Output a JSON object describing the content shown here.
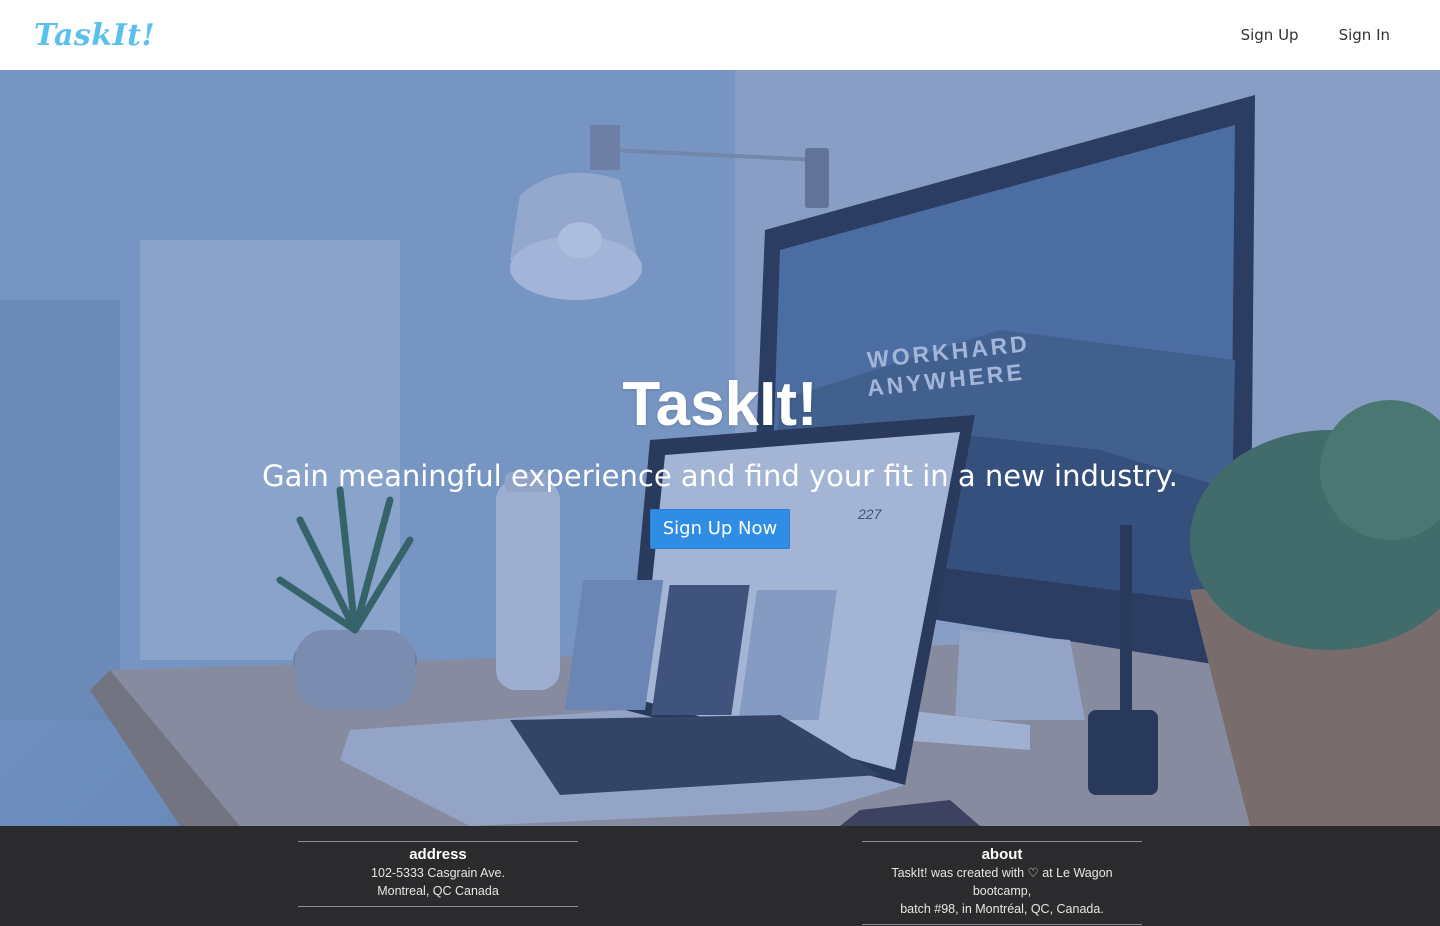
{
  "navbar": {
    "brand": "TaskIt!",
    "links": [
      "Sign Up",
      "Sign In"
    ]
  },
  "hero": {
    "title": "TaskIt!",
    "subtitle": "Gain meaningful experience and find your fit in a new industry.",
    "cta_label": "Sign Up Now",
    "background_scene": {
      "monitor_screen_text_1": "WORKHARD",
      "monitor_screen_text_2": "ANYWHERE",
      "laptop_stat": "227"
    }
  },
  "footer": {
    "address": {
      "heading": "address",
      "lines": [
        "102-5333 Casgrain Ave.",
        "Montreal, QC Canada"
      ]
    },
    "about": {
      "heading": "about",
      "lines": [
        "TaskIt! was created with ♡ at Le Wagon bootcamp,",
        "batch #98, in Montréal, QC, Canada."
      ]
    }
  },
  "colors": {
    "brand": "#5bc0eb",
    "cta": "#2f8de4",
    "footer_bg": "#2b2b2e",
    "hero_overlay": "#2650aa"
  }
}
